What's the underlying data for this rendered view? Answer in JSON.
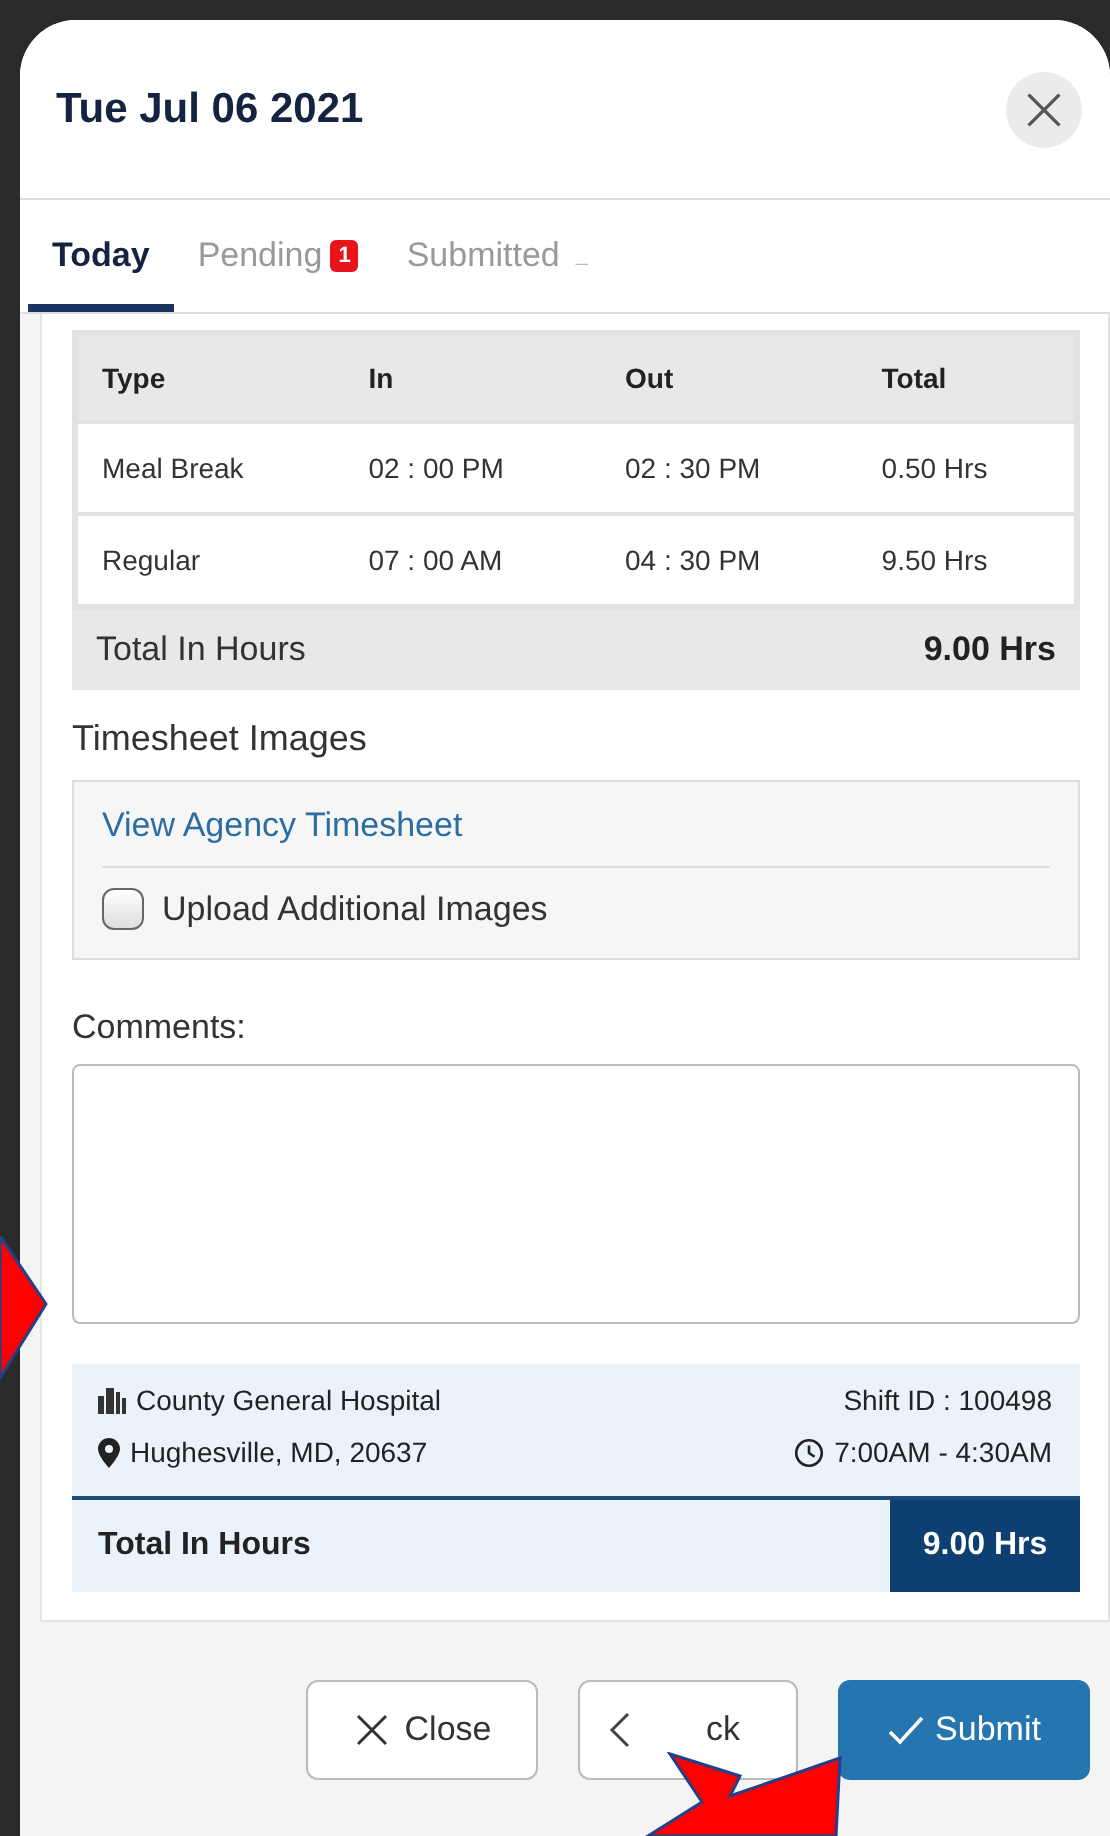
{
  "header": {
    "title": "Tue Jul 06 2021"
  },
  "tabs": [
    {
      "label": "Today",
      "selected": true
    },
    {
      "label": "Pending",
      "selected": false,
      "badge": "1"
    },
    {
      "label": "Submitted",
      "selected": false,
      "suffix": "_"
    }
  ],
  "table": {
    "columns": [
      "Type",
      "In",
      "Out",
      "Total"
    ],
    "rows": [
      [
        "Meal Break",
        "02 : 00 PM",
        "02 : 30 PM",
        "0.50 Hrs"
      ],
      [
        "Regular",
        "07 : 00 AM",
        "04 : 30 PM",
        "9.50 Hrs"
      ]
    ],
    "total_label": "Total In Hours",
    "total_value": "9.00 Hrs"
  },
  "timesheet_images": {
    "heading": "Timesheet Images",
    "link": "View Agency Timesheet",
    "upload_label": "Upload Additional Images",
    "upload_checked": false
  },
  "comments": {
    "label": "Comments:"
  },
  "shift": {
    "facility": "County General Hospital",
    "shift_id": "Shift ID : 100498",
    "location": "Hughesville, MD, 20637",
    "time": "7:00AM - 4:30AM",
    "total_label": "Total In Hours",
    "total_value": "9.00 Hrs"
  },
  "buttons": [
    {
      "kind": "close",
      "label": "Close"
    },
    {
      "kind": "back",
      "label": "ck"
    },
    {
      "kind": "submit",
      "label": "Submit"
    }
  ]
}
